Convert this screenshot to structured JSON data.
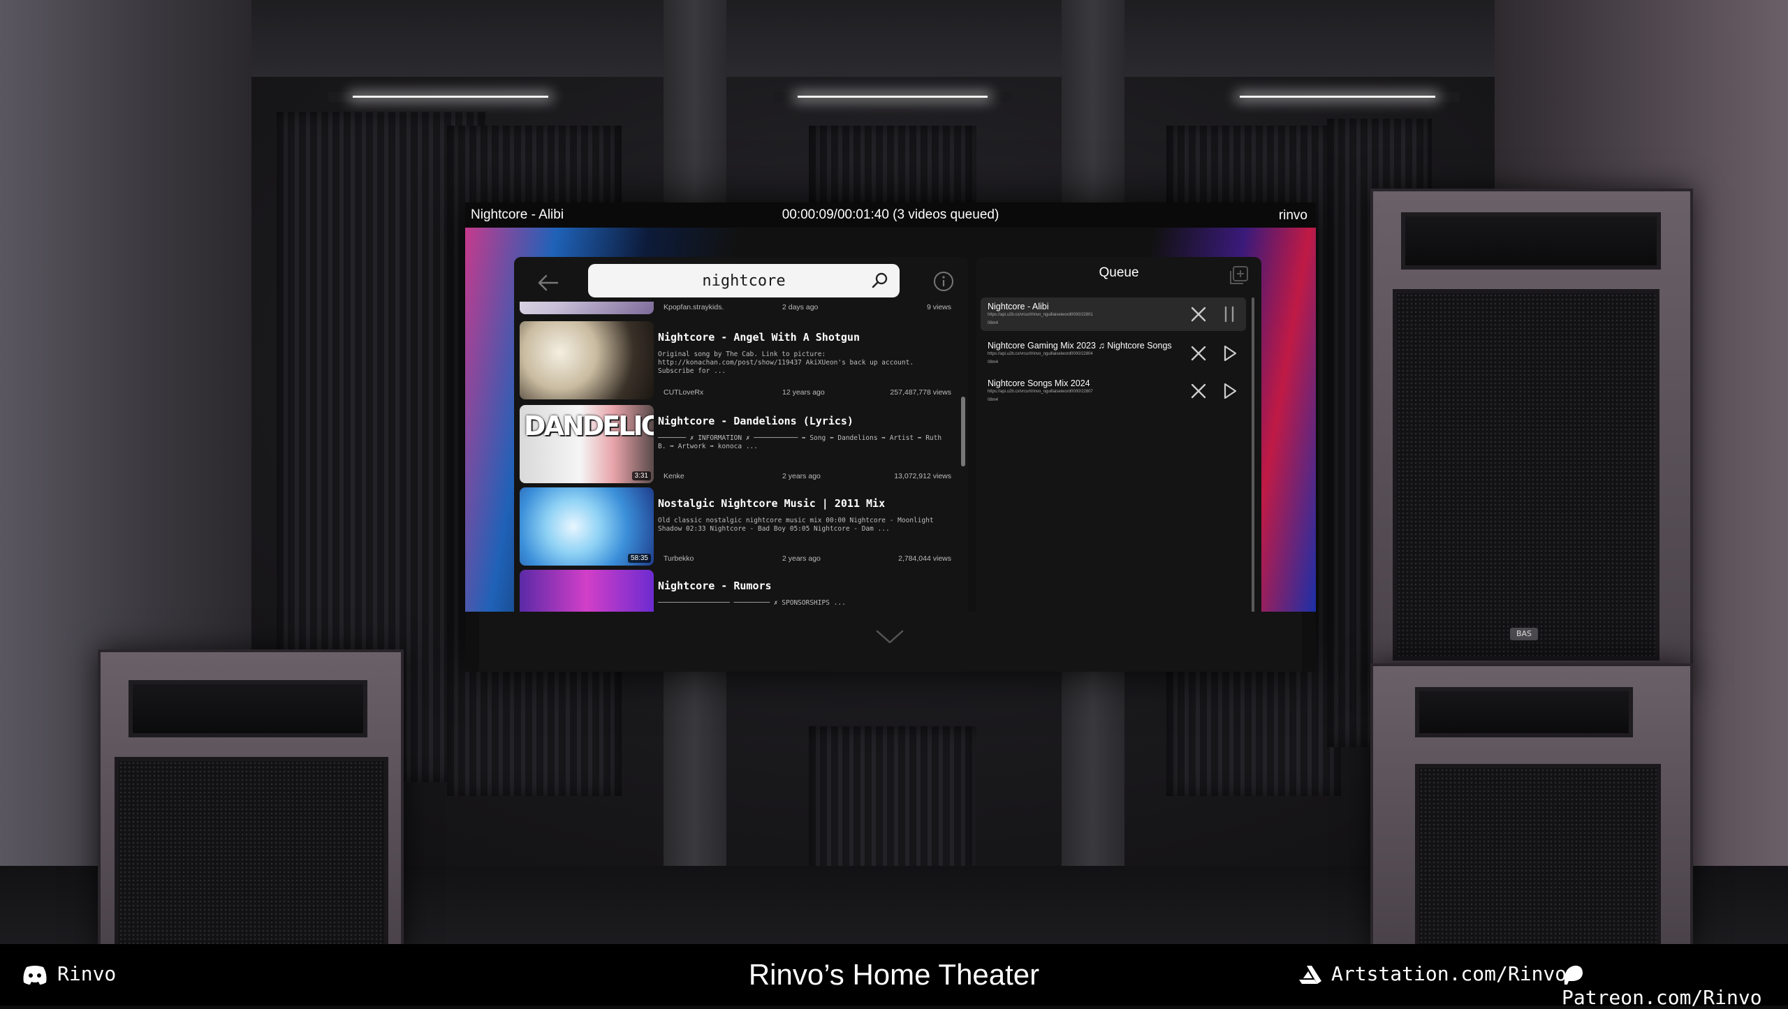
{
  "player": {
    "now_playing": "Nightcore - Alibi",
    "time_status": "00:00:09/00:01:40 (3 videos queued)",
    "user": "rinvo"
  },
  "search": {
    "query": "nightcore",
    "results": [
      {
        "title": "",
        "description": "",
        "channel": "Kpopfan.straykids.",
        "ago": "2 days ago",
        "views": "9 views",
        "duration": ""
      },
      {
        "title": "Nightcore - Angel With A Shotgun",
        "description": "Original song by The Cab. Link to picture: http://konachan.com/post/show/119437 AkiXUeon's back up account. Subscribe for ...",
        "channel": "CUTLoveRx",
        "ago": "12 years ago",
        "views": "257,487,778 views",
        "duration": ""
      },
      {
        "title": "Nightcore - Dandelions (Lyrics)",
        "description": "─────── ✗ INFORMATION ✗ ─────────── ➡ Song ⬅ Dandelions ➡ Artist ➡ Ruth B. ➡ Artwork ➡ konoca ...",
        "channel": "Kenke",
        "ago": "2 years ago",
        "views": "13,072,912 views",
        "duration": "3:31",
        "thumb_text": "DANDELIONS"
      },
      {
        "title": "Nostalgic Nightcore Music | 2011 Mix",
        "description": "Old classic nostalgic nightcore music mix 00:00 Nightcore - Moonlight Shadow 02:33 Nightcore - Bad Boy 05:05 Nightcore - Dam ...",
        "channel": "Turbekko",
        "ago": "2 years ago",
        "views": "2,784,044 views",
        "duration": "58:35"
      },
      {
        "title": "Nightcore - Rumors",
        "description": "────────────────── ───────── ✗ SPONSORSHIPS ...",
        "channel": "",
        "ago": "",
        "views": "",
        "duration": ""
      }
    ]
  },
  "queue": {
    "title": "Queue",
    "items": [
      {
        "title": "Nightcore - Alibi",
        "url": "https://api.u2b.cx/vrcurl/rinvo_nguillaiseiword0000/22801",
        "duration": "08m4"
      },
      {
        "title": "Nightcore Gaming Mix 2023 ♫ Nightcore Songs",
        "url": "https://api.u2b.cx/vrcurl/rinvo_nguillaiseiword0000/22804",
        "duration": "08m4"
      },
      {
        "title": "Nightcore Songs Mix 2024",
        "url": "https://api.u2b.cx/vrcurl/rinvo_nguillaiseiword0000/22807",
        "duration": "08m4"
      }
    ]
  },
  "footer": {
    "discord": "Rinvo",
    "title": "Rinvo’s Home Theater",
    "artstation": "Artstation.com/Rinvo",
    "patreon": "Patreon.com/Rinvo"
  },
  "icons": [
    "back-arrow-icon",
    "search-icon",
    "info-icon",
    "add-queue-icon",
    "close-icon",
    "pause-icon",
    "play-icon",
    "chevron-down-icon",
    "discord-icon",
    "artstation-icon",
    "patreon-icon"
  ]
}
